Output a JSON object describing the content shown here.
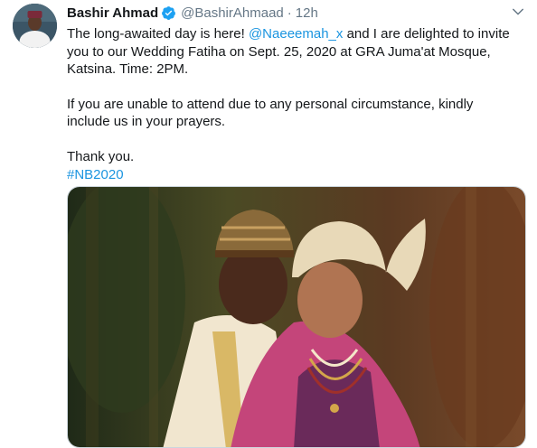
{
  "tweet": {
    "author_name": "Bashir Ahmad",
    "author_handle": "@BashirAhmaad",
    "separator": "·",
    "timestamp": "12h",
    "text_line1_pre": "The long-awaited day is here! ",
    "mention": "@Naeeemah_x",
    "text_line1_post": " and I are delighted to invite you to our Wedding Fatiha on Sept. 25, 2020 at GRA Juma'at Mosque, Katsina. Time: 2PM.",
    "text_para2": "If you are unable to attend due to any personal circumstance, kindly include us in your prayers.",
    "text_thanks": "Thank you.",
    "hashtag": "#NB2020"
  },
  "icons": {
    "verified": "verified-badge-icon",
    "more": "chevron-down-icon"
  },
  "colors": {
    "link": "#1b95e0",
    "secondary": "#657786",
    "verified": "#1da1f2"
  }
}
